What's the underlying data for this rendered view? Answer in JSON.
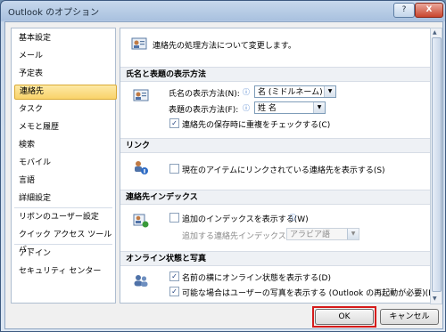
{
  "window": {
    "title": "Outlook のオプション",
    "help_label": "?",
    "close_label": "X"
  },
  "nav": {
    "items": [
      {
        "label": "基本設定"
      },
      {
        "label": "メール"
      },
      {
        "label": "予定表"
      },
      {
        "label": "連絡先"
      },
      {
        "label": "タスク"
      },
      {
        "label": "メモと履歴"
      },
      {
        "label": "検索"
      },
      {
        "label": "モバイル"
      },
      {
        "label": "言語"
      },
      {
        "label": "詳細設定"
      },
      {
        "label": "リボンのユーザー設定"
      },
      {
        "label": "クイック アクセス ツール バー"
      },
      {
        "label": "アドイン"
      },
      {
        "label": "セキュリティ センター"
      }
    ],
    "selected_index": 3
  },
  "content": {
    "intro": "連絡先の処理方法について変更します。",
    "sections": {
      "names": {
        "heading": "氏名と表題の表示方法",
        "full_name_label": "氏名の表示方法(N):",
        "full_name_value": "名 (ミドルネーム) 姓",
        "file_as_label": "表題の表示方法(F):",
        "file_as_value": "姓 名",
        "dup_check_label": "連絡先の保存時に重複をチェックする(C)",
        "dup_check_checked": true
      },
      "linking": {
        "heading": "リンク",
        "show_linked_label": "現在のアイテムにリンクされている連絡先を表示する(S)",
        "show_linked_checked": false
      },
      "index": {
        "heading": "連絡先インデックス",
        "show_index_label": "追加のインデックスを表示する(W)",
        "show_index_checked": false,
        "add_index_label": "追加する連絡先インデックス(X):",
        "add_index_value": "アラビア語"
      },
      "online": {
        "heading": "オンライン状態と写真",
        "status_label": "名前の横にオンライン状態を表示する(D)",
        "status_checked": true,
        "photos_label": "可能な場合はユーザーの写真を表示する (Outlook の再起動が必要)(P)",
        "photos_checked": true
      }
    }
  },
  "footer": {
    "ok_label": "OK",
    "cancel_label": "キャンセル"
  },
  "colors": {
    "highlight_frame": "#d51b1b",
    "selected_nav": "#f9d36a",
    "info_icon": "#2f6cc5"
  }
}
